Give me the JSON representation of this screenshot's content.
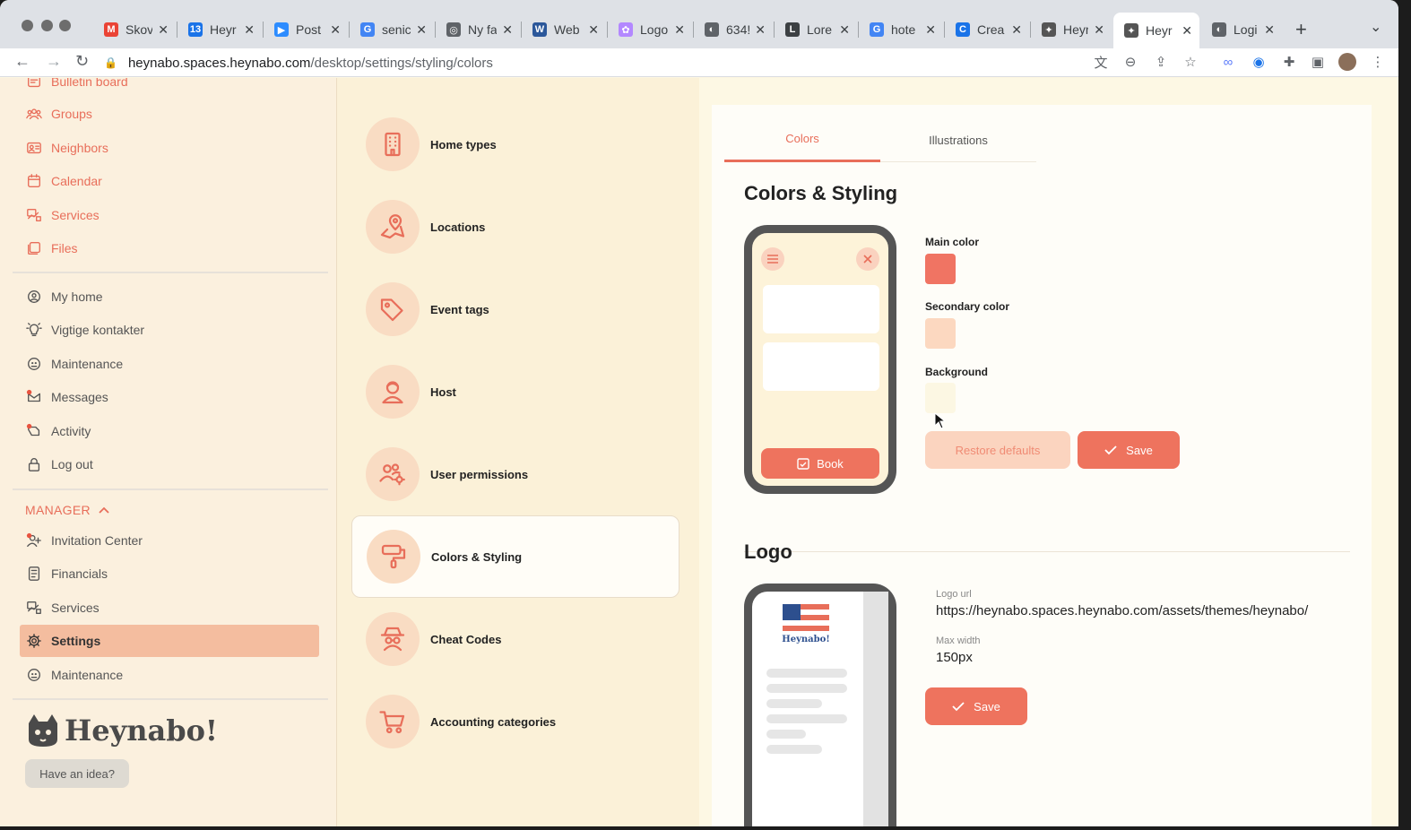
{
  "browser": {
    "tabs": [
      {
        "label": "Skov",
        "fav": "M",
        "fav_color": "#ea4335"
      },
      {
        "label": "Heyr",
        "fav": "13",
        "fav_color": "#1a73e8"
      },
      {
        "label": "Post",
        "fav": "▶",
        "fav_color": "#2d8cff"
      },
      {
        "label": "senic",
        "fav": "G",
        "fav_color": "#4285f4"
      },
      {
        "label": "Ny fa",
        "fav": "◎",
        "fav_color": "#5f6368"
      },
      {
        "label": "Web",
        "fav": "W",
        "fav_color": "#2b579a"
      },
      {
        "label": "Logo",
        "fav": "✿",
        "fav_color": "#b388ff"
      },
      {
        "label": "634!",
        "fav": "◐",
        "fav_color": "#5f6368"
      },
      {
        "label": "Lore",
        "fav": "L",
        "fav_color": "#3c4043"
      },
      {
        "label": "hote",
        "fav": "G",
        "fav_color": "#4285f4"
      },
      {
        "label": "Crea",
        "fav": "C",
        "fav_color": "#1a73e8"
      },
      {
        "label": "Heyr",
        "fav": "✦",
        "fav_color": "#555555"
      },
      {
        "label": "Heyr",
        "fav": "✦",
        "fav_color": "#555555"
      },
      {
        "label": "Logi",
        "fav": "◐",
        "fav_color": "#5f6368"
      }
    ],
    "active_tab_index": 12,
    "url_domain": "heynabo.spaces.heynabo.com",
    "url_path": "/desktop/settings/styling/colors"
  },
  "sidebar": {
    "items": [
      {
        "label": "Bulletin board",
        "icon": "bulletin-icon",
        "accent": true
      },
      {
        "label": "Groups",
        "icon": "groups-icon",
        "accent": true
      },
      {
        "label": "Neighbors",
        "icon": "neighbors-icon",
        "accent": true
      },
      {
        "label": "Calendar",
        "icon": "calendar-icon",
        "accent": true
      },
      {
        "label": "Services",
        "icon": "services-icon",
        "accent": true
      },
      {
        "label": "Files",
        "icon": "files-icon",
        "accent": true
      },
      {
        "label": "My home",
        "icon": "home-icon",
        "accent": false
      },
      {
        "label": "Vigtige kontakter",
        "icon": "lightbulb-icon",
        "accent": false
      },
      {
        "label": "Maintenance",
        "icon": "maintenance-icon",
        "accent": false
      },
      {
        "label": "Messages",
        "icon": "messages-icon",
        "accent": false
      },
      {
        "label": "Activity",
        "icon": "activity-icon",
        "accent": false
      },
      {
        "label": "Log out",
        "icon": "lock-icon",
        "accent": false
      }
    ],
    "manager_heading": "MANAGER",
    "manager_items": [
      {
        "label": "Invitation Center",
        "icon": "invite-icon"
      },
      {
        "label": "Financials",
        "icon": "financials-icon"
      },
      {
        "label": "Services",
        "icon": "services-icon"
      },
      {
        "label": "Settings",
        "icon": "gear-icon",
        "selected": true
      },
      {
        "label": "Maintenance",
        "icon": "maintenance-icon"
      }
    ],
    "logo_text": "Heynabo!",
    "idea_button": "Have an idea?"
  },
  "settings_list": [
    {
      "label": "Home types",
      "icon": "building-icon"
    },
    {
      "label": "Locations",
      "icon": "map-pin-icon"
    },
    {
      "label": "Event tags",
      "icon": "tags-icon"
    },
    {
      "label": "Host",
      "icon": "host-icon"
    },
    {
      "label": "User permissions",
      "icon": "user-permissions-icon"
    },
    {
      "label": "Colors & Styling",
      "icon": "paint-roller-icon",
      "active": true
    },
    {
      "label": "Cheat Codes",
      "icon": "spy-icon"
    },
    {
      "label": "Accounting categories",
      "icon": "cart-icon"
    }
  ],
  "content": {
    "tabs": [
      "Colors",
      "Illustrations"
    ],
    "active_tab": "Colors",
    "colors_title": "Colors & Styling",
    "main_color_label": "Main color",
    "main_color": "#f07463",
    "secondary_color_label": "Secondary color",
    "secondary_color": "#fcd8c0",
    "background_label": "Background",
    "background_color": "#fcf7e3",
    "restore_button": "Restore defaults",
    "save_button": "Save",
    "phone_book_button": "Book",
    "logo_title": "Logo",
    "logo_url_label": "Logo url",
    "logo_url_value": "https://heynabo.spaces.heynabo.com/assets/themes/heynabo/",
    "max_width_label": "Max width",
    "max_width_value": "150px",
    "logo_save_button": "Save",
    "preview_logo_text": "Heynabo!"
  }
}
